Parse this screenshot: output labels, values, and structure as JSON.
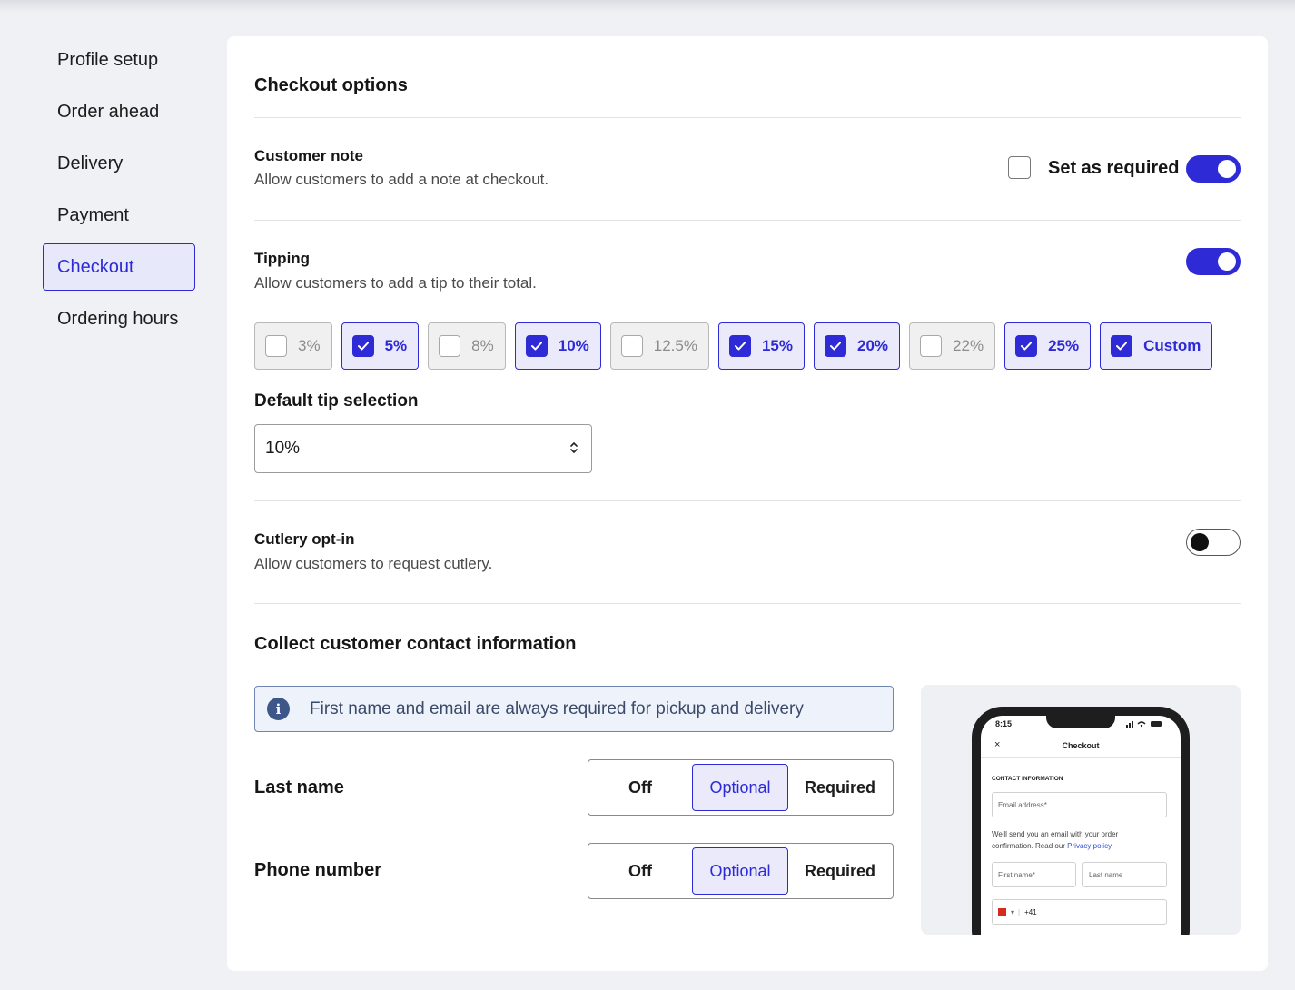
{
  "sidebar": {
    "items": [
      {
        "label": "Profile setup",
        "active": false
      },
      {
        "label": "Order ahead",
        "active": false
      },
      {
        "label": "Delivery",
        "active": false
      },
      {
        "label": "Payment",
        "active": false
      },
      {
        "label": "Checkout",
        "active": true
      },
      {
        "label": "Ordering hours",
        "active": false
      }
    ]
  },
  "colors": {
    "accent": "#2e2ad6",
    "accent_bg": "#eaeafb",
    "info_border": "#6f86b1"
  },
  "checkout": {
    "title": "Checkout options",
    "customer_note": {
      "title": "Customer note",
      "description": "Allow customers to add a note at checkout.",
      "required_label": "Set as required",
      "required_checked": false,
      "enabled": true
    },
    "tipping": {
      "title": "Tipping",
      "description": "Allow customers to add a tip to their total.",
      "enabled": true,
      "options": [
        {
          "label": "3%",
          "checked": false
        },
        {
          "label": "5%",
          "checked": true
        },
        {
          "label": "8%",
          "checked": false
        },
        {
          "label": "10%",
          "checked": true
        },
        {
          "label": "12.5%",
          "checked": false
        },
        {
          "label": "15%",
          "checked": true
        },
        {
          "label": "20%",
          "checked": true
        },
        {
          "label": "22%",
          "checked": false
        },
        {
          "label": "25%",
          "checked": true
        },
        {
          "label": "Custom",
          "checked": true
        }
      ],
      "default_label": "Default tip selection",
      "default_value": "10%"
    },
    "cutlery": {
      "title": "Cutlery opt-in",
      "description": "Allow customers to request cutlery.",
      "enabled": false
    },
    "contact": {
      "title": "Collect customer contact information",
      "info": "First name and email are always required for pickup and delivery",
      "info_icon": "info-icon",
      "fields": [
        {
          "label": "Last name",
          "options": [
            "Off",
            "Optional",
            "Required"
          ],
          "selected": "Optional"
        },
        {
          "label": "Phone number",
          "options": [
            "Off",
            "Optional",
            "Required"
          ],
          "selected": "Optional"
        }
      ]
    }
  },
  "preview": {
    "time": "8:15",
    "close": "×",
    "title": "Checkout",
    "section": "CONTACT INFORMATION",
    "email_placeholder": "Email address*",
    "note_text": "We'll send you an email with your order confirmation. Read our",
    "note_link": "Privacy policy",
    "first_name": "First name*",
    "last_name": "Last name",
    "phone_code": "+41"
  }
}
